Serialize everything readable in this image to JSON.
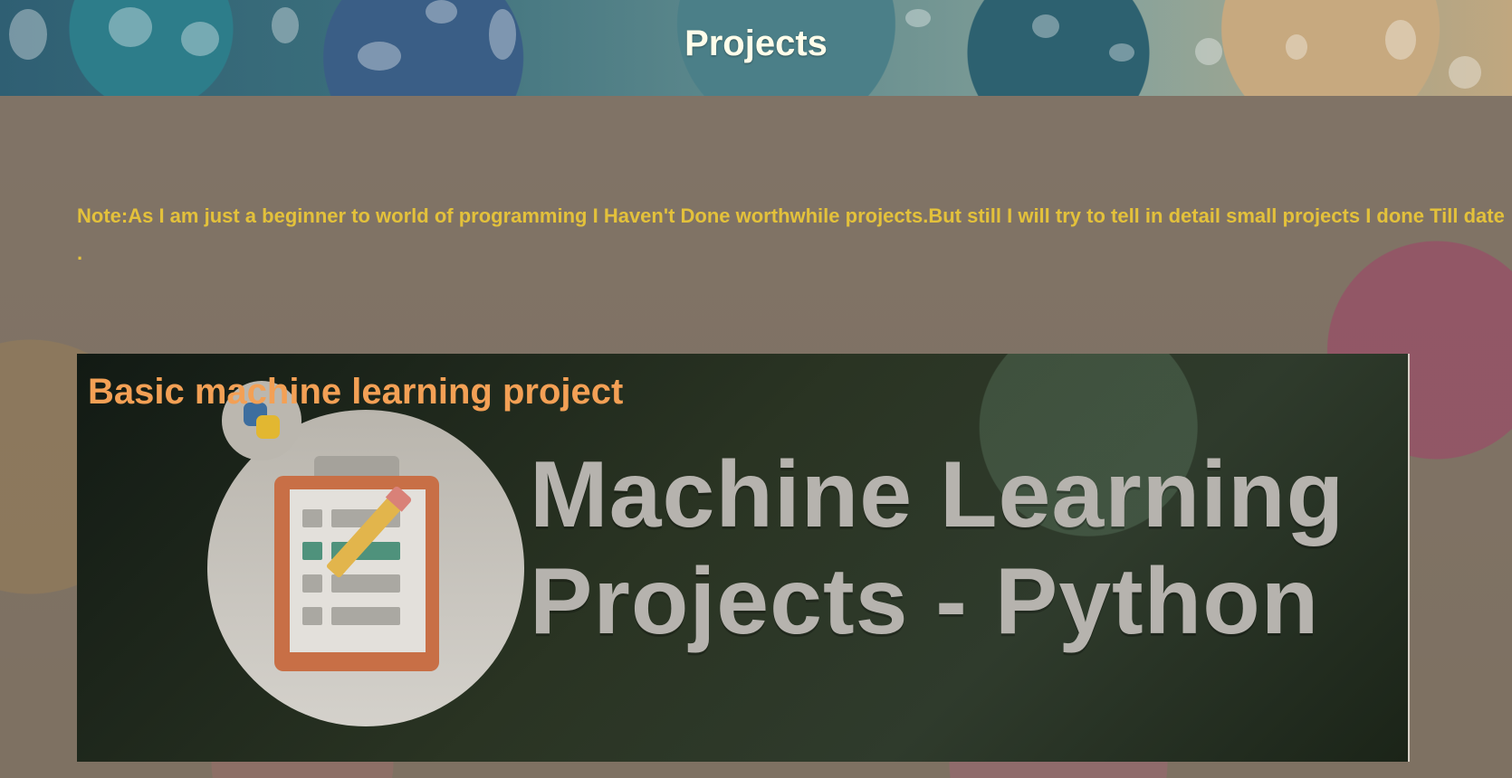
{
  "header": {
    "title": "Projects"
  },
  "note": {
    "text": "Note:As I am just a beginner to world of programming I Haven't Done worthwhile projects.But still I will try to tell in detail small projects I done Till date ."
  },
  "project_card": {
    "title": "Basic machine learning project",
    "banner_line_1": "Machine Learning",
    "banner_line_2": "Projects - Python"
  }
}
